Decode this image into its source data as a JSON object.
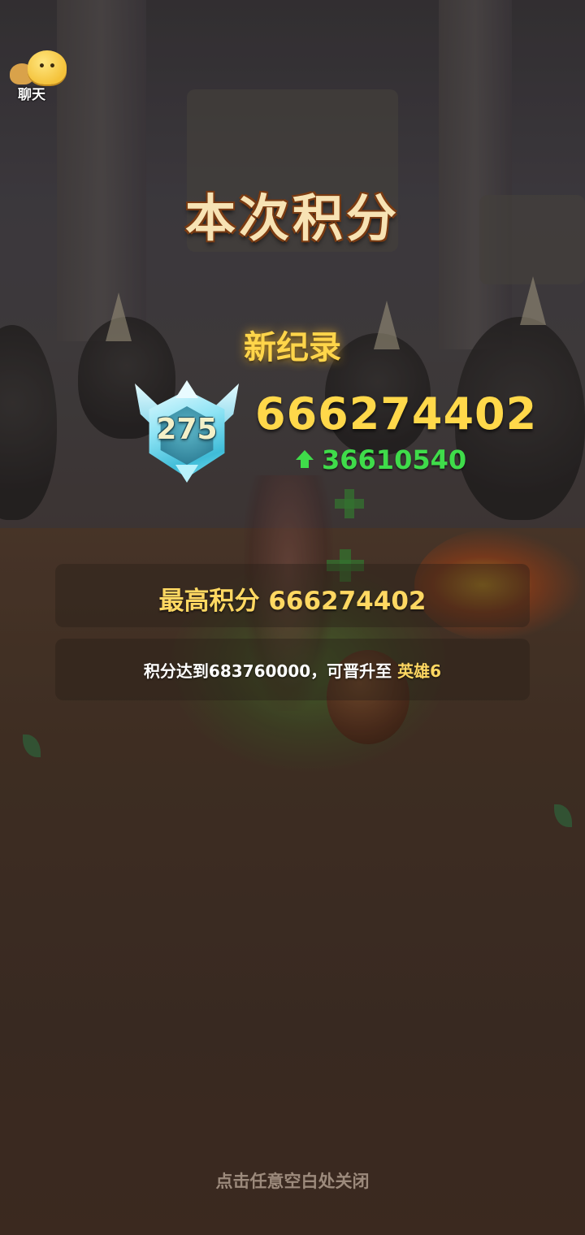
{
  "chat": {
    "label": "聊天",
    "icon": "chat-bubble-icon"
  },
  "result": {
    "title": "本次积分",
    "badge_text": "新纪录",
    "rank_level": "275",
    "score": "666274402",
    "score_increase": "36610540",
    "best_label": "最高积分",
    "best_score": "666274402",
    "promotion": {
      "prefix": "积分达到",
      "target_score": "683760000",
      "middle": "，可晋升至 ",
      "next_rank": "英雄6"
    }
  },
  "close_hint": "点击任意空白处关闭",
  "colors": {
    "gold": "#ffd84a",
    "increase_green": "#3fdc4a",
    "title_cream": "#f7e3b4",
    "panel_bg": "rgba(40,30,24,0.42)"
  }
}
